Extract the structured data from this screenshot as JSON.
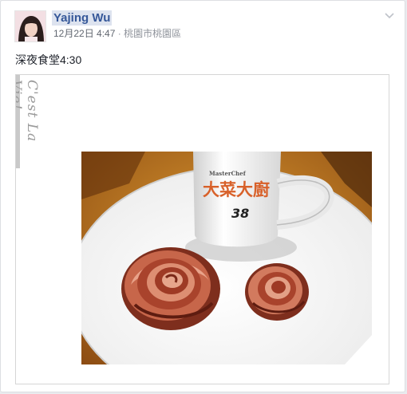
{
  "post": {
    "author": "Yajing Wu",
    "date": "12月22日 4:47",
    "separator": "·",
    "location": "桃園市桃園區",
    "text": "深夜食堂4:30",
    "photo": {
      "side_caption": "C'est La Vie!",
      "mug_brand": "MasterChef",
      "mug_text": "大菜大廚",
      "mug_number": "38"
    }
  }
}
